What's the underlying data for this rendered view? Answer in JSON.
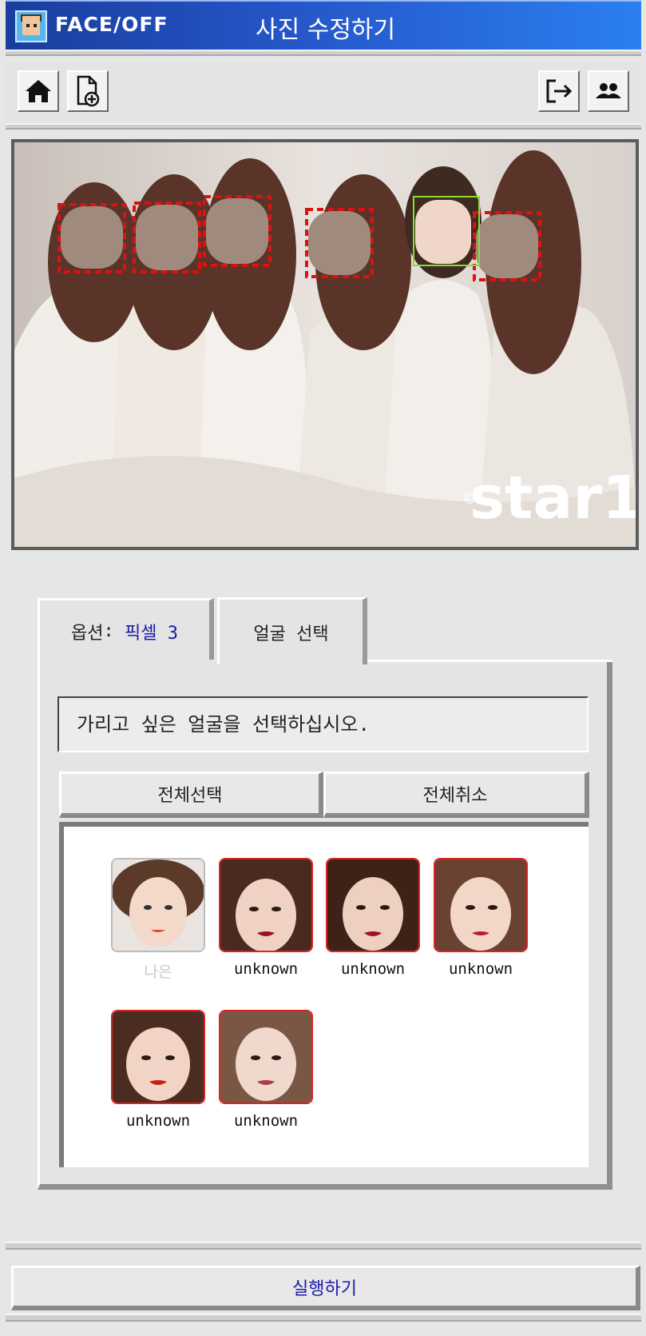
{
  "titlebar": {
    "app_name": "FACE/OFF",
    "page_title": "사진 수정하기"
  },
  "toolbar": {
    "left": [
      {
        "icon": "home-icon"
      },
      {
        "icon": "add-file-icon"
      }
    ],
    "right": [
      {
        "icon": "logout-icon"
      },
      {
        "icon": "users-icon"
      }
    ]
  },
  "photo": {
    "watermark": "star1",
    "watermark_mark": "©"
  },
  "tabs": {
    "option_label": "옵션",
    "option_sep": ": ",
    "option_value": "픽셀 3",
    "face_select_label": "얼굴 선택"
  },
  "panel": {
    "instruction": "가리고 싶은 얼굴을 선택하십시오.",
    "select_all": "전체선택",
    "deselect_all": "전체취소"
  },
  "faces": [
    {
      "label": "나은",
      "selected": false
    },
    {
      "label": "unknown",
      "selected": true
    },
    {
      "label": "unknown",
      "selected": true
    },
    {
      "label": "unknown",
      "selected": true
    },
    {
      "label": "unknown",
      "selected": true
    },
    {
      "label": "unknown",
      "selected": true
    }
  ],
  "run_button": {
    "label": "실행하기"
  },
  "colors": {
    "accent_blue": "#1a1aa8",
    "selected_face": "#dd1111",
    "recognized_face": "#88dd33",
    "titlebar": "#2556c8"
  }
}
